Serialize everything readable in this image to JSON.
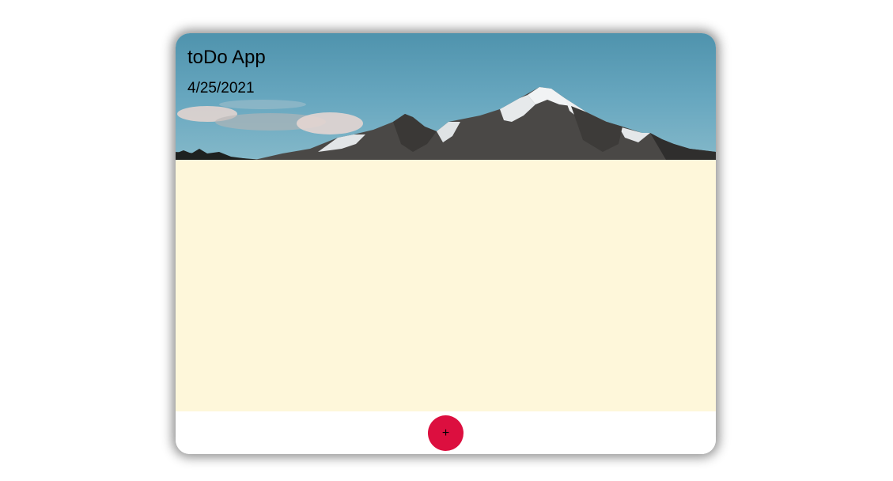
{
  "header": {
    "title": "toDo App",
    "date": "4/25/2021"
  },
  "todos": [],
  "footer": {
    "add_label": "+"
  },
  "colors": {
    "list_background": "#fef7da",
    "add_button": "#dc0f3f",
    "sky": "#5f9fb8"
  }
}
